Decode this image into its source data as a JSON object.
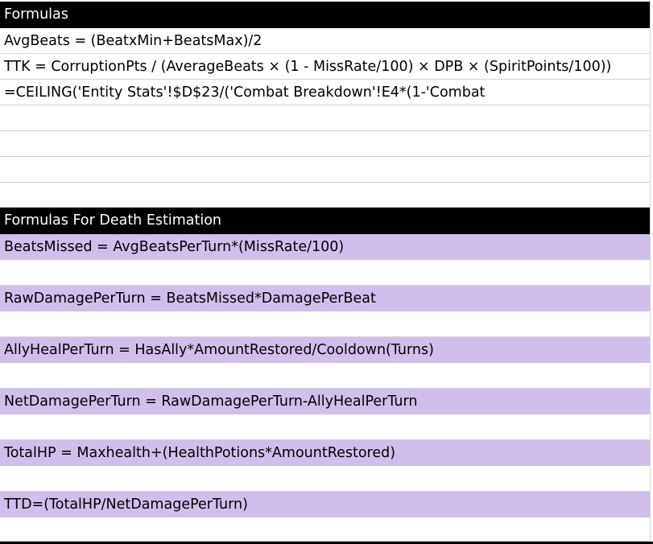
{
  "section1": {
    "header": "Formulas",
    "rows": [
      "AvgBeats = (BeatxMin+BeatsMax)/2",
      "TTK = CorruptionPts / (AverageBeats × (1 - MissRate/100) × DPB × (SpiritPoints/100))",
      "=CEILING('Entity Stats'!$D$23/('Combat Breakdown'!E4*(1-'Combat"
    ]
  },
  "section2": {
    "header": "Formulas For Death Estimation",
    "rows": [
      "BeatsMissed = AvgBeatsPerTurn*(MissRate/100)",
      "RawDamagePerTurn = BeatsMissed*DamagePerBeat",
      "AllyHealPerTurn = HasAlly*AmountRestored/Cooldown(Turns)",
      "NetDamagePerTurn = RawDamagePerTurn-AllyHealPerTurn",
      "TotalHP = Maxhealth+(HealthPotions*AmountRestored)",
      "TTD=(TotalHP/NetDamagePerTurn)"
    ]
  },
  "colors": {
    "header_bg": "#000000",
    "header_text": "#ffffff",
    "highlight_bg": "#d0bfea",
    "gridline": "#d4d4d4"
  }
}
